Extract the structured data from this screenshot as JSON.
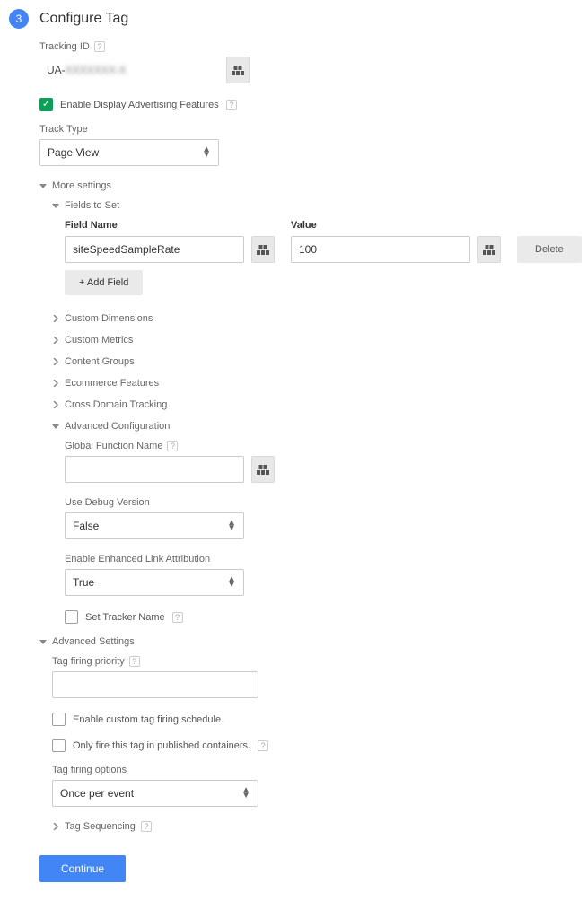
{
  "step_number": "3",
  "title": "Configure Tag",
  "tracking_id": {
    "label": "Tracking ID",
    "value": "UA-",
    "redacted": "XXXXXXX-X"
  },
  "display_ad": {
    "label": "Enable Display Advertising Features",
    "checked": true
  },
  "track_type": {
    "label": "Track Type",
    "value": "Page View"
  },
  "more_settings": {
    "label": "More settings",
    "fields_to_set": {
      "label": "Fields to Set",
      "field_name_header": "Field Name",
      "value_header": "Value",
      "rows": [
        {
          "name": "siteSpeedSampleRate",
          "value": "100"
        }
      ],
      "add_label": "+ Add Field",
      "delete_label": "Delete"
    },
    "collapsed": {
      "custom_dimensions": "Custom Dimensions",
      "custom_metrics": "Custom Metrics",
      "content_groups": "Content Groups",
      "ecommerce": "Ecommerce Features",
      "cross_domain": "Cross Domain Tracking"
    },
    "advanced_config": {
      "label": "Advanced Configuration",
      "global_fn": {
        "label": "Global Function Name",
        "value": ""
      },
      "debug": {
        "label": "Use Debug Version",
        "value": "False"
      },
      "enhanced_link": {
        "label": "Enable Enhanced Link Attribution",
        "value": "True"
      },
      "set_tracker": {
        "label": "Set Tracker Name",
        "checked": false
      }
    }
  },
  "advanced_settings": {
    "label": "Advanced Settings",
    "priority": {
      "label": "Tag firing priority",
      "value": ""
    },
    "custom_schedule": {
      "label": "Enable custom tag firing schedule.",
      "checked": false
    },
    "only_published": {
      "label": "Only fire this tag in published containers.",
      "checked": false
    },
    "firing_options": {
      "label": "Tag firing options",
      "value": "Once per event"
    },
    "tag_sequencing": "Tag Sequencing"
  },
  "continue_label": "Continue"
}
